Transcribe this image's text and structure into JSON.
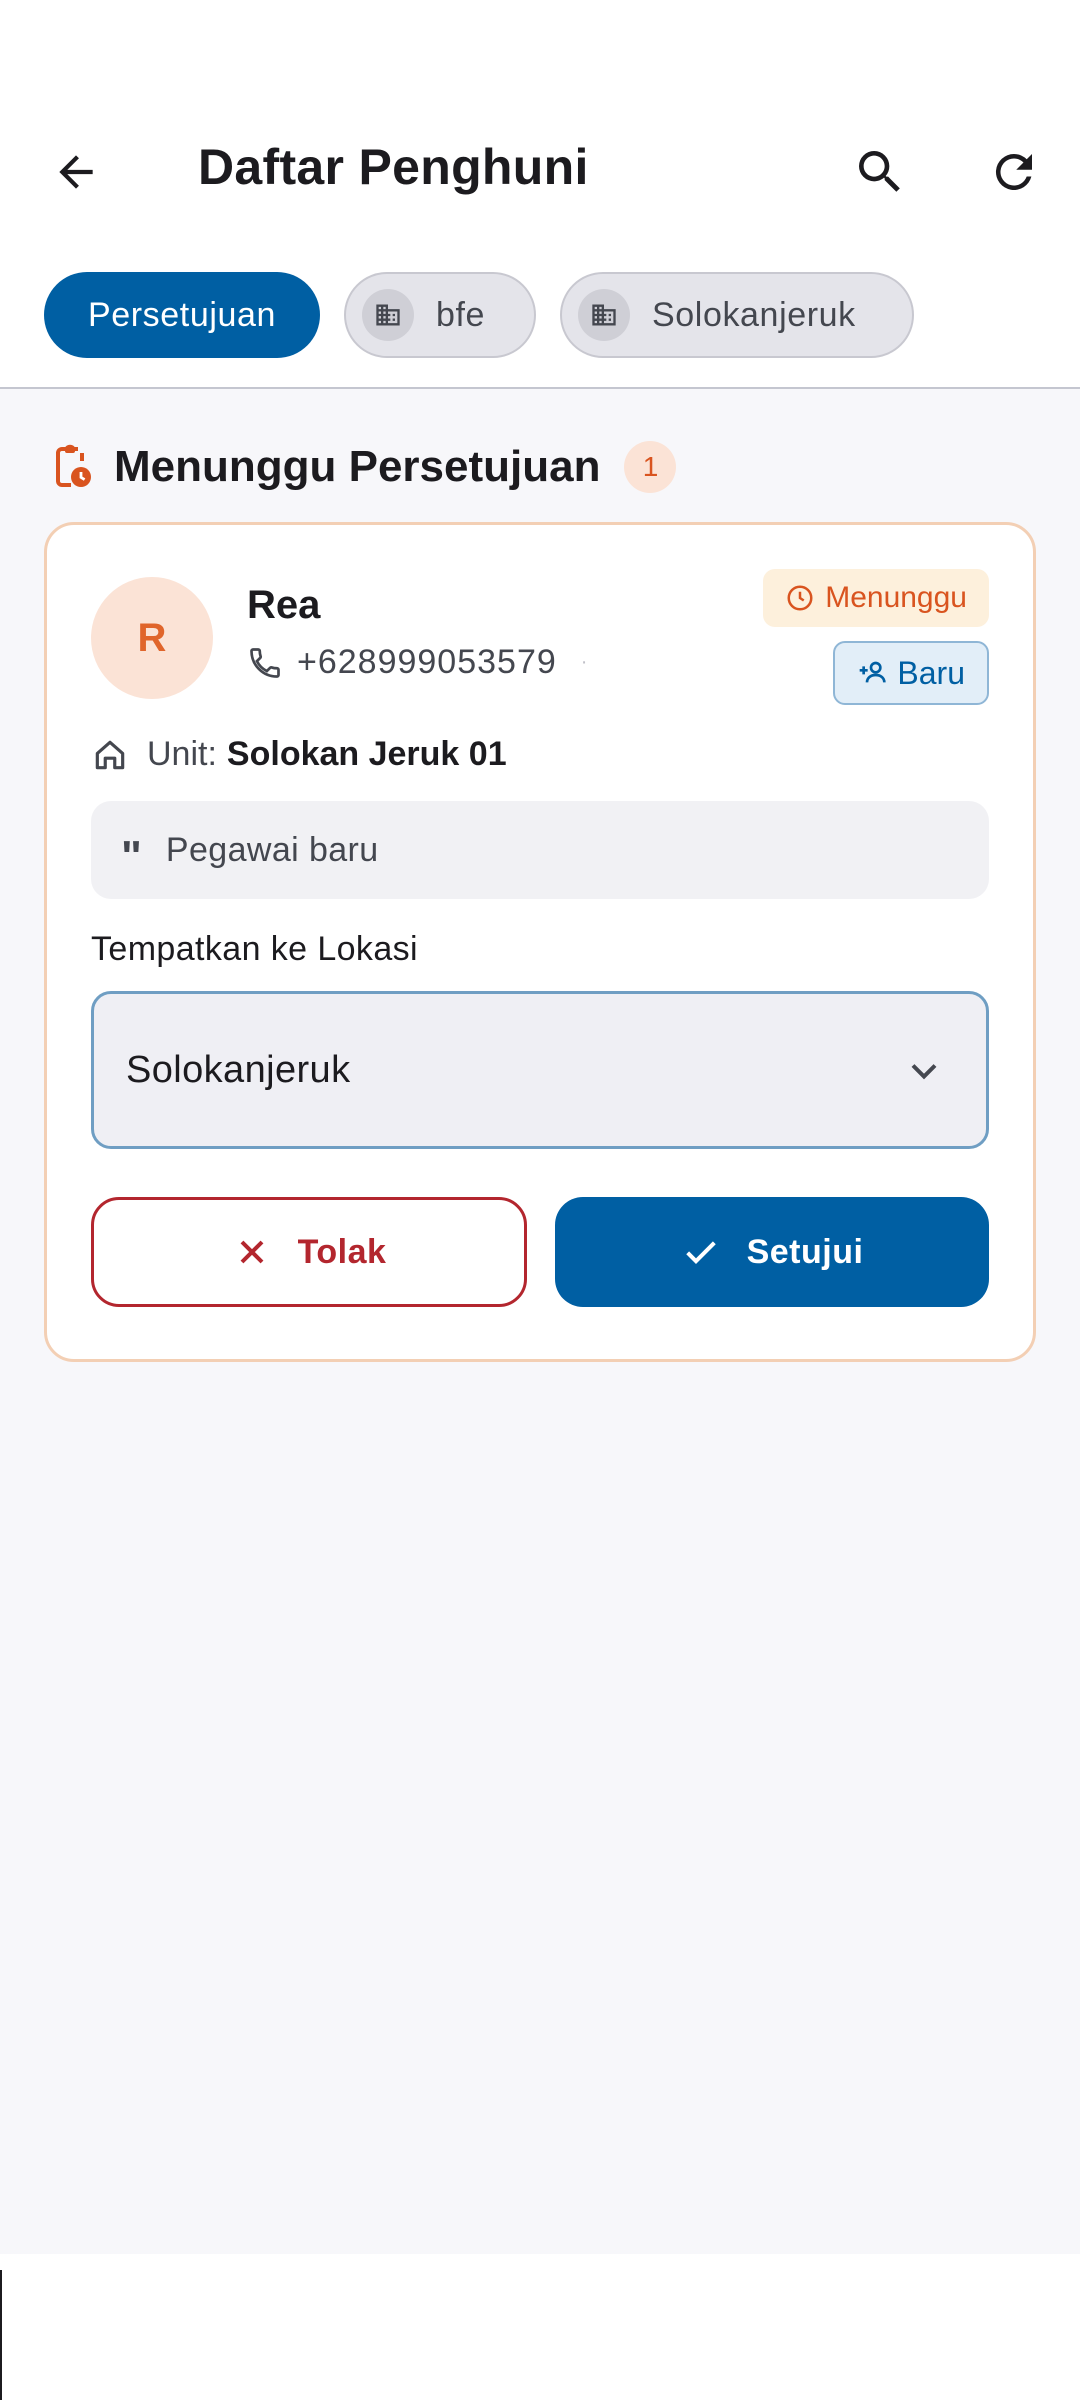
{
  "appbar": {
    "title": "Daftar Penghuni"
  },
  "filters": {
    "chips": [
      {
        "label": "Persetujuan",
        "selected": true
      },
      {
        "label": "bfe",
        "icon": "building-icon"
      },
      {
        "label": "Solokanjeruk",
        "icon": "building-icon"
      }
    ]
  },
  "section": {
    "title": "Menunggu Persetujuan",
    "count": "1"
  },
  "request": {
    "avatar_initial": "R",
    "name": "Rea",
    "phone": "+628999053579",
    "status_label": "Menunggu",
    "new_label": "Baru",
    "unit_label": "Unit:",
    "unit_value": "Solokan Jeruk 01",
    "note": "Pegawai baru",
    "location_label": "Tempatkan ke Lokasi",
    "location_selected": "Solokanjeruk",
    "reject_label": "Tolak",
    "approve_label": "Setujui"
  },
  "colors": {
    "primary": "#005fa3",
    "warning": "#d9541f",
    "danger": "#b3262e",
    "background": "#f7f7fa"
  }
}
